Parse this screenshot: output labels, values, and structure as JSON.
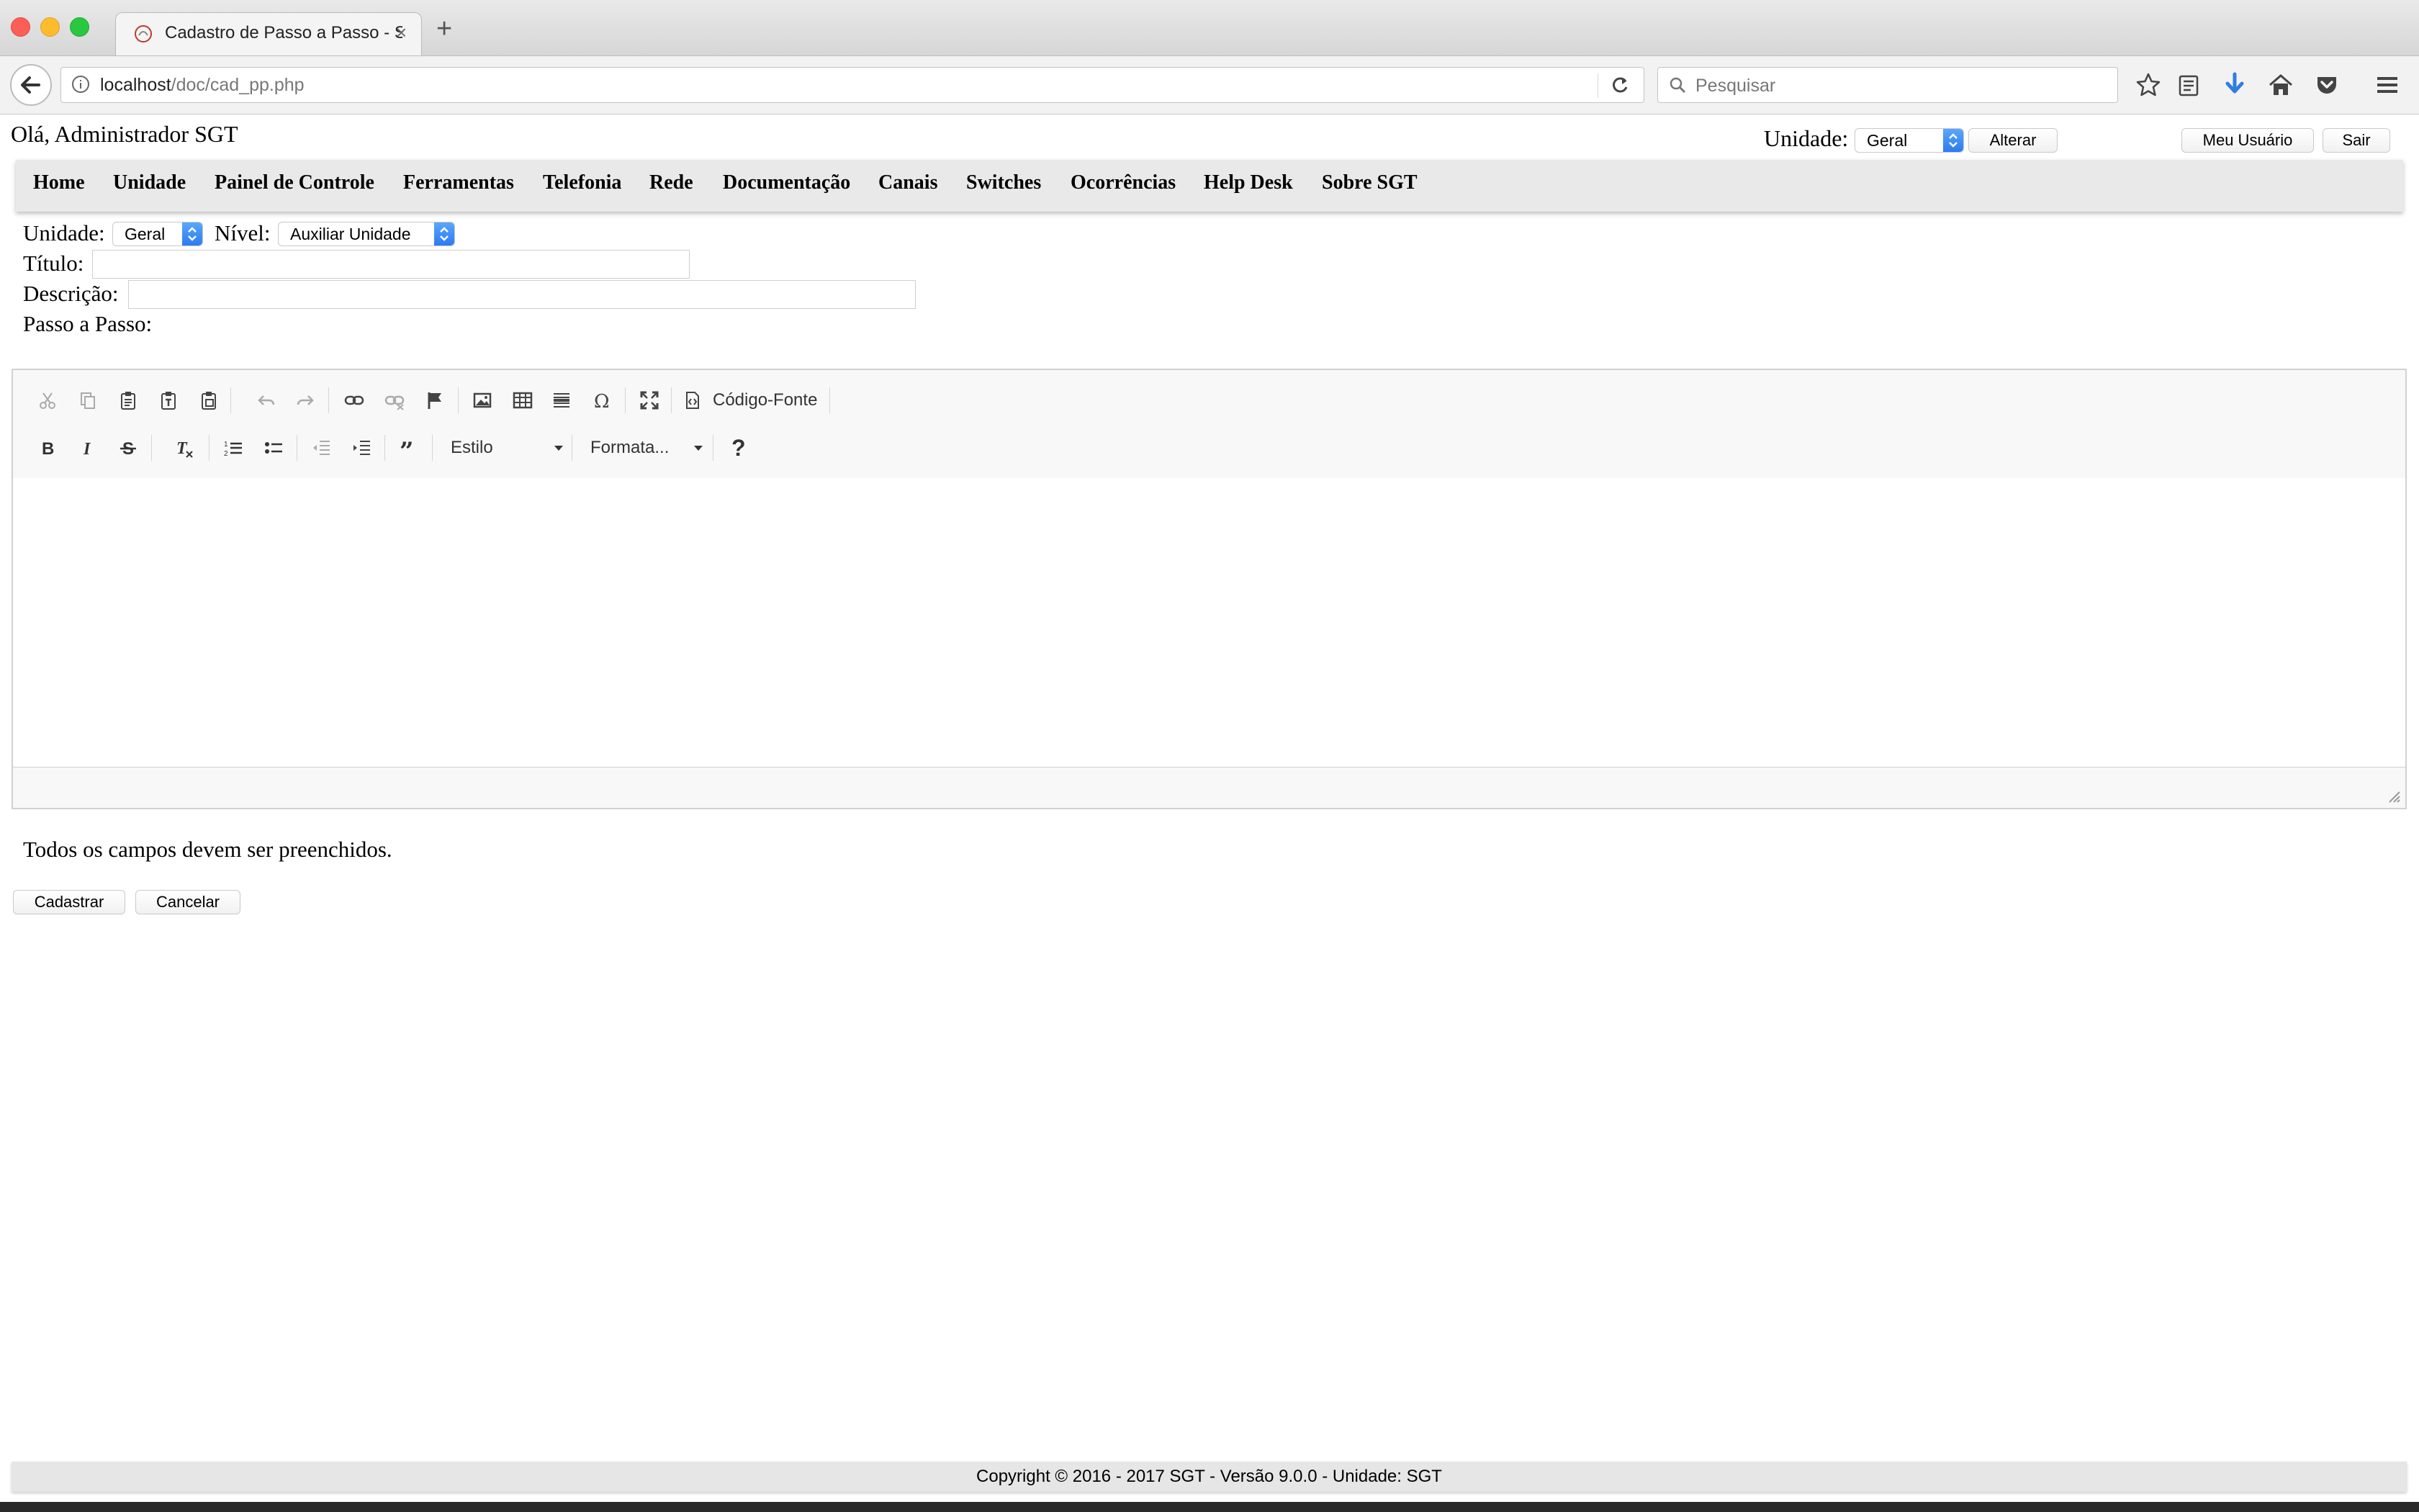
{
  "browser": {
    "tab_title": "Cadastro de Passo a Passo - SGT",
    "tab_close": "×",
    "new_tab": "+",
    "url_host": "localhost",
    "url_path": "/doc/cad_pp.php",
    "search_placeholder": "Pesquisar"
  },
  "header": {
    "greeting": "Olá, Administrador SGT",
    "unit_label": "Unidade:",
    "unit_value": "Geral",
    "change_button": "Alterar",
    "my_user_button": "Meu Usuário",
    "logout_button": "Sair"
  },
  "menu": {
    "items": [
      "Home",
      "Unidade",
      "Painel de Controle",
      "Ferramentas",
      "Telefonia",
      "Rede",
      "Documentação",
      "Canais",
      "Switches",
      "Ocorrências",
      "Help Desk",
      "Sobre SGT"
    ]
  },
  "form": {
    "unit_label": "Unidade:",
    "unit_value": "Geral",
    "level_label": "Nível:",
    "level_value": "Auxiliar Unidade",
    "title_label": "Título:",
    "title_value": "",
    "description_label": "Descrição:",
    "description_value": "",
    "steps_label": "Passo a Passo:"
  },
  "editor": {
    "source_button": "Código-Fonte",
    "style_combo": "Estilo",
    "format_combo": "Formata...",
    "help_button": "?"
  },
  "notice": "Todos os campos devem ser preenchidos.",
  "actions": {
    "submit": "Cadastrar",
    "cancel": "Cancelar"
  },
  "footer": "Copyright © 2016 - 2017 SGT - Versão 9.0.0 - Unidade: SGT"
}
